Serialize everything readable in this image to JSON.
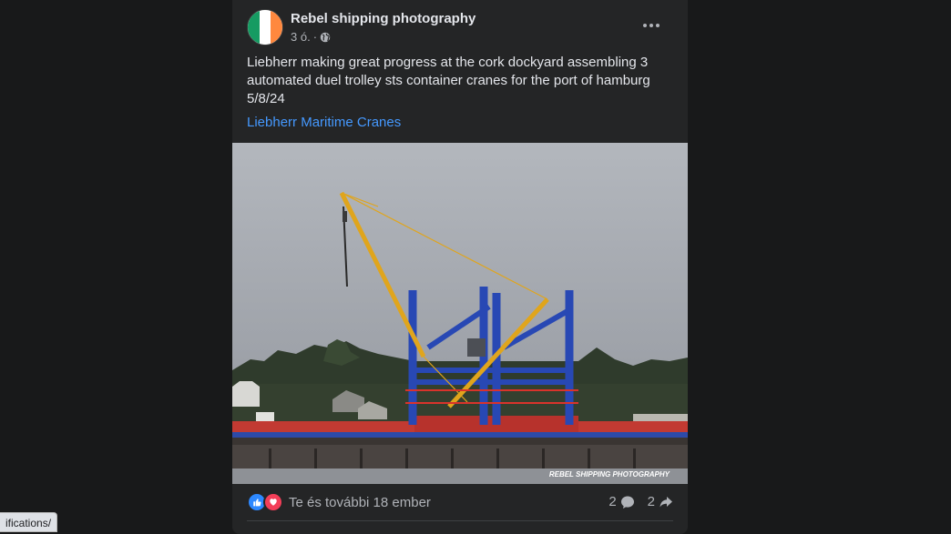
{
  "post": {
    "page_name": "Rebel shipping photography",
    "time": "3 ó.",
    "separator": "·",
    "text": "Liebherr making great progress at the cork dockyard assembling 3 automated duel trolley sts container cranes for the port of hamburg 5/8/24",
    "link": "Liebherr Maritime Cranes",
    "photo_watermark": "REBEL SHIPPING PHOTOGRAPHY",
    "avatar_colors": [
      "#169b62",
      "#ffffff",
      "#ff883e"
    ],
    "reactions": {
      "text": "Te és további 18 ember",
      "icons": [
        "like-icon",
        "love-icon"
      ]
    },
    "comments_count": "2",
    "shares_count": "2"
  },
  "status_bar": {
    "url": "ifications/"
  }
}
